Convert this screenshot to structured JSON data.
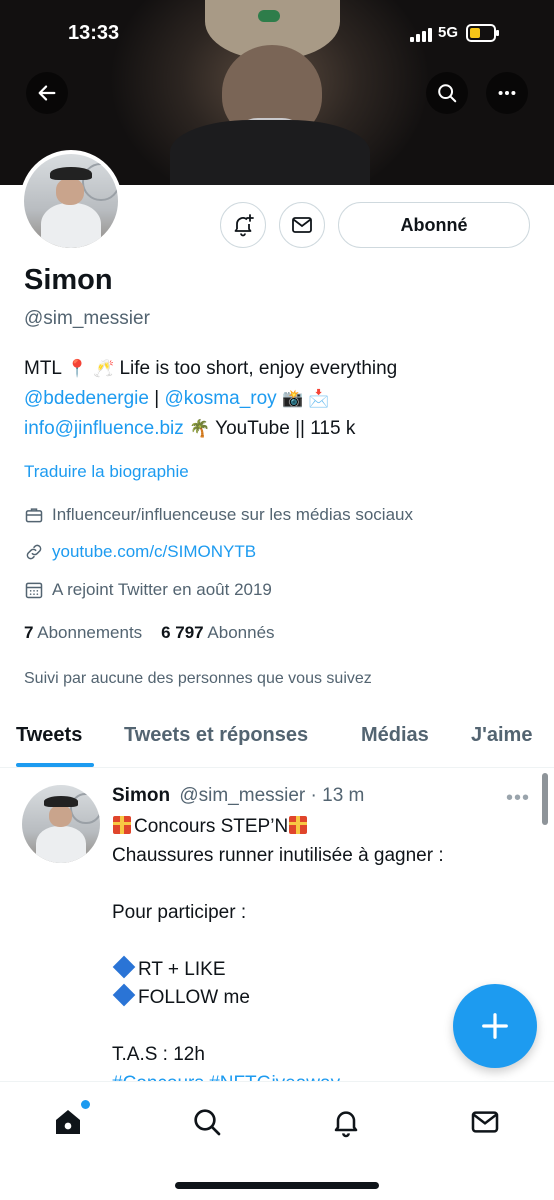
{
  "status_bar": {
    "time": "13:33",
    "network": "5G"
  },
  "header": {
    "back_icon": "arrow-left-icon",
    "search_icon": "search-icon",
    "more_icon": "more-horizontal-icon"
  },
  "profile": {
    "name": "Simon",
    "handle": "@sim_messier",
    "follow_button": "Abonné",
    "bio": {
      "line1_text_a": "MTL",
      "line1_text_b": "Life is too short, enjoy everything",
      "line2_mention1": "@bdedenergie",
      "line2_sep": " | ",
      "line2_mention2": "@kosma_roy",
      "line3_email": "info@jinfluence.biz",
      "line3_text": "YouTube || 115 k"
    },
    "translate_label": "Traduire la biographie",
    "category": "Influenceur/influenceuse sur les médias sociaux",
    "website": "youtube.com/c/SIMONYTB",
    "joined": "A rejoint Twitter en août 2019",
    "following_count": "7",
    "following_label": "Abonnements",
    "followers_count": "6 797",
    "followers_label": "Abonnés",
    "followed_by": "Suivi par aucune des personnes que vous suivez"
  },
  "tabs": [
    {
      "label": "Tweets",
      "active": true
    },
    {
      "label": "Tweets et réponses",
      "active": false
    },
    {
      "label": "Médias",
      "active": false
    },
    {
      "label": "J'aime",
      "active": false
    }
  ],
  "tweet": {
    "author_name": "Simon",
    "author_meta": "@sim_messier · 13 m",
    "more": "•••",
    "title": "Concours STEP’N",
    "line2": "Chaussures runner inutilisée à gagner :",
    "line3": "Pour participer :",
    "line4": "RT + LIKE",
    "line5": "FOLLOW me",
    "line6": "T.A.S : 12h",
    "line7": "#Concours #NFTGiveaway"
  },
  "bottom_nav": {
    "items": [
      "home-icon",
      "search-icon",
      "bell-icon",
      "mail-icon"
    ]
  },
  "colors": {
    "accent": "#1d9bf0",
    "text": "#0f1419",
    "muted": "#536471"
  }
}
